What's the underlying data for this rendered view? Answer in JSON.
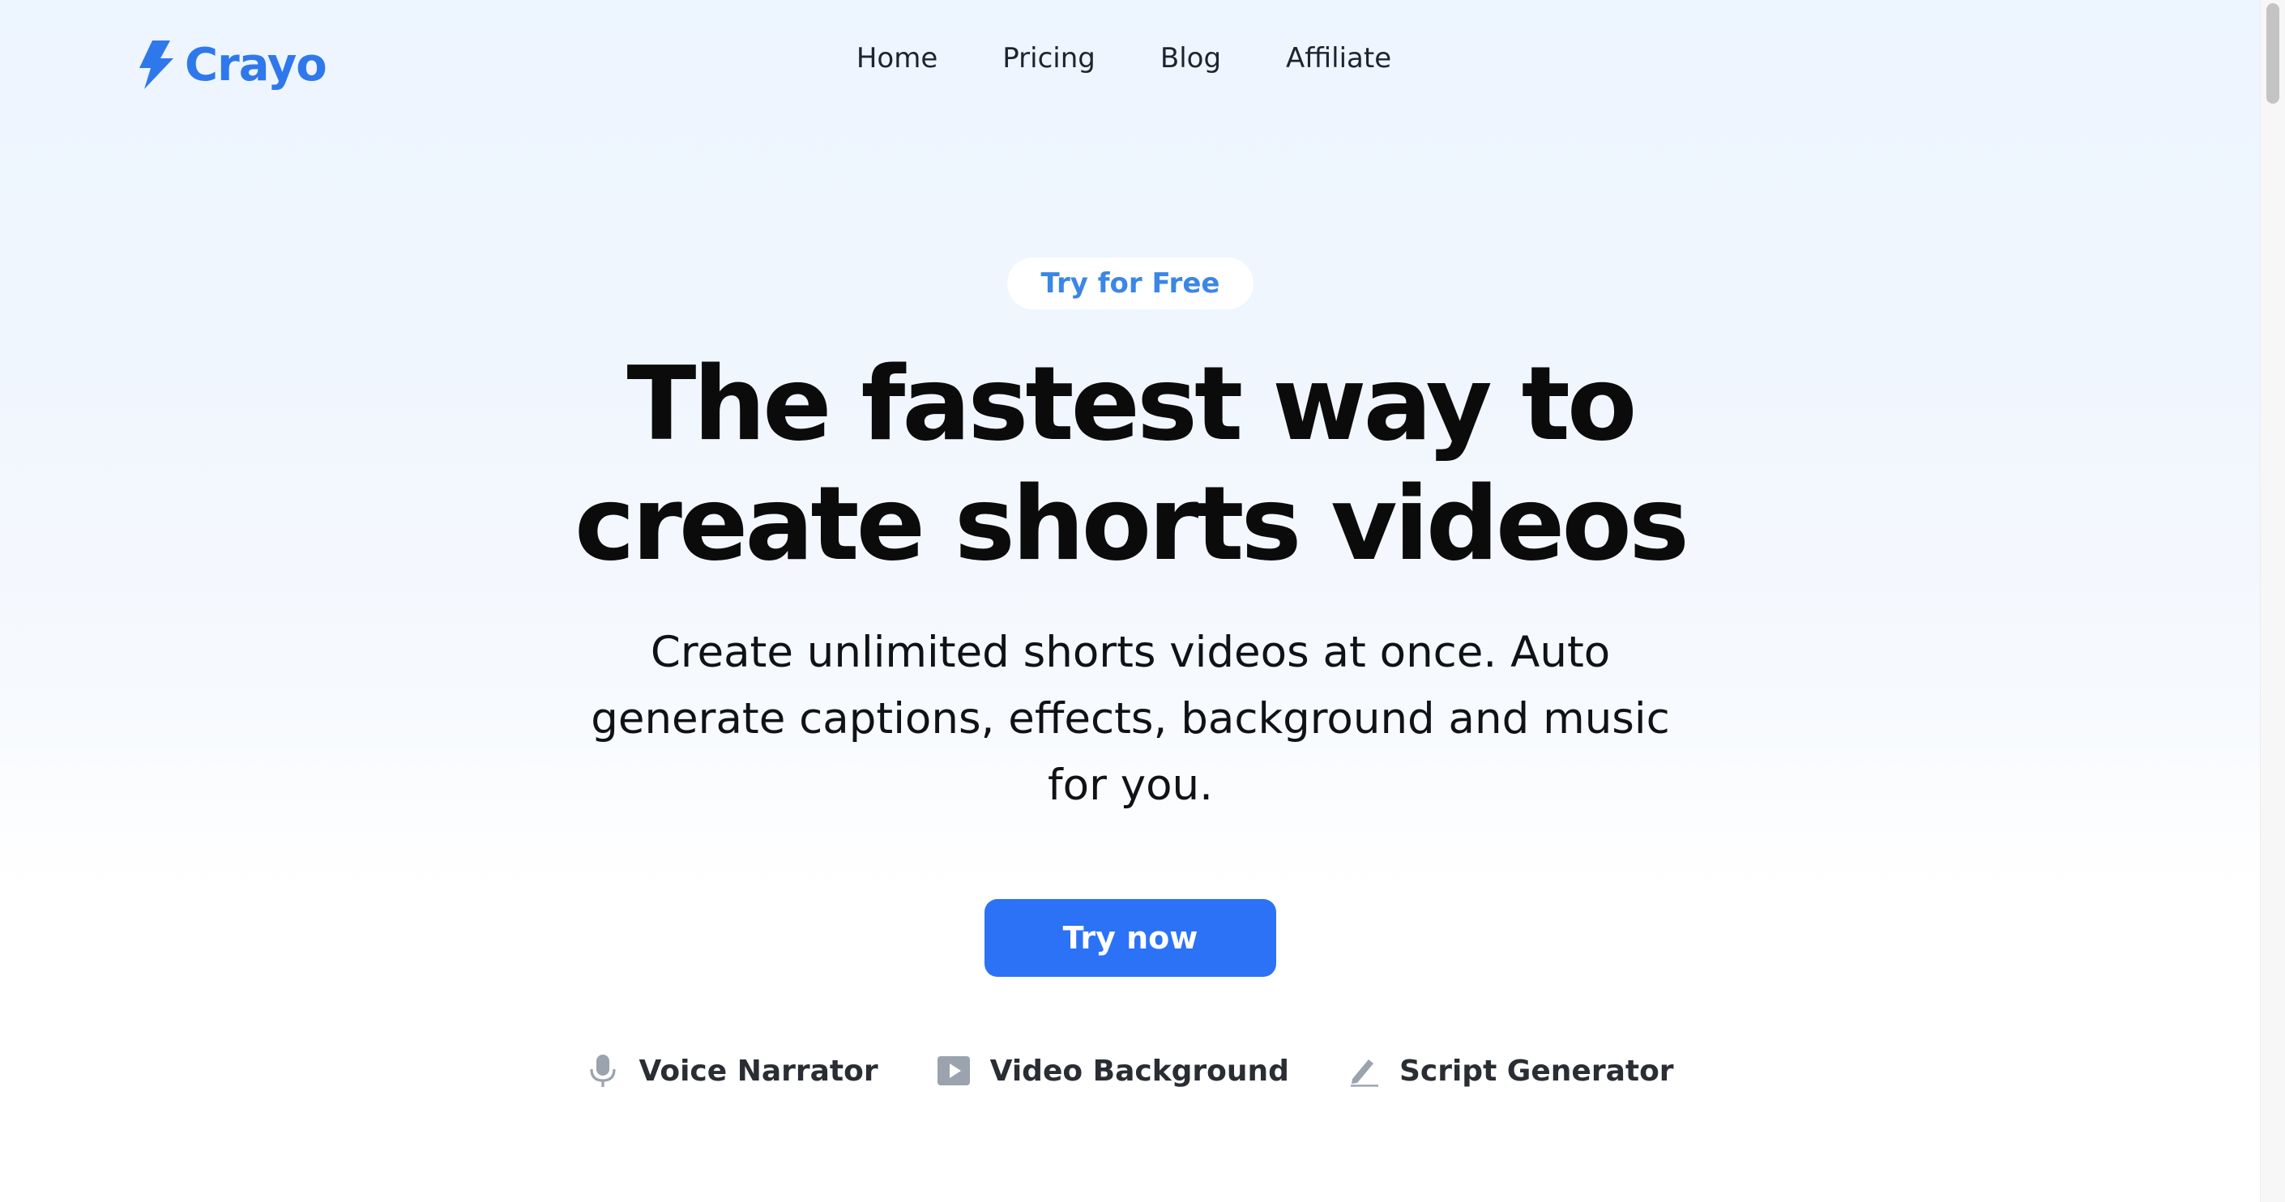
{
  "brand": {
    "name": "Crayo",
    "color": "#2f78ec",
    "icon": "lightning-bolt-icon"
  },
  "nav": {
    "items": [
      {
        "label": "Home"
      },
      {
        "label": "Pricing"
      },
      {
        "label": "Blog"
      },
      {
        "label": "Affiliate"
      }
    ]
  },
  "hero": {
    "badge": "Try for Free",
    "headline": "The fastest way to create shorts videos",
    "subheadline": "Create unlimited shorts videos at once. Auto generate captions, effects, background and music for you.",
    "cta_label": "Try now",
    "cta_color": "#2b72f6"
  },
  "features": [
    {
      "label": "Voice Narrator",
      "icon": "microphone-icon"
    },
    {
      "label": "Video Background",
      "icon": "play-icon"
    },
    {
      "label": "Script Generator",
      "icon": "pencil-icon"
    }
  ]
}
